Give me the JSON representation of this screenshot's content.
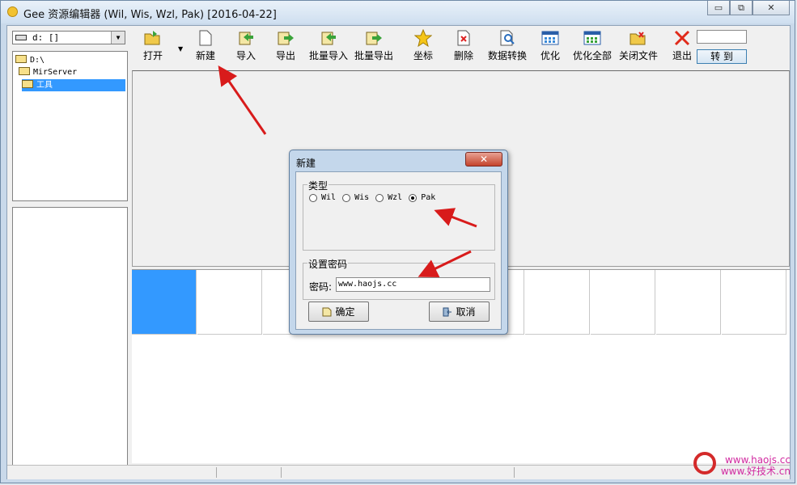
{
  "window": {
    "title": "Gee 资源编辑器 (Wil, Wis, Wzl, Pak) [2016-04-22]"
  },
  "window_buttons": {
    "minimize": "▭",
    "restore": "⧉",
    "close": "✕"
  },
  "drive": {
    "value": "d: []"
  },
  "tree": {
    "items": [
      "D:\\",
      "MirServer",
      "工具"
    ],
    "selected": "工具"
  },
  "toolbar": {
    "items": [
      {
        "label": "打开",
        "icon": "open-folder-icon"
      },
      {
        "label": "新建",
        "icon": "new-file-icon"
      },
      {
        "label": "导入",
        "icon": "import-icon"
      },
      {
        "label": "导出",
        "icon": "export-icon"
      },
      {
        "label": "批量导入",
        "icon": "batch-import-icon"
      },
      {
        "label": "批量导出",
        "icon": "batch-export-icon"
      },
      {
        "label": "坐标",
        "icon": "star-icon"
      },
      {
        "label": "删除",
        "icon": "delete-icon"
      },
      {
        "label": "数据转换",
        "icon": "convert-icon"
      },
      {
        "label": "优化",
        "icon": "optimize-icon"
      },
      {
        "label": "优化全部",
        "icon": "optimize-all-icon"
      },
      {
        "label": "关闭文件",
        "icon": "close-file-icon"
      },
      {
        "label": "退出",
        "icon": "exit-icon"
      }
    ],
    "goto_label": "转 到",
    "goto_value": ""
  },
  "dialog": {
    "title": "新建",
    "close": "✕",
    "type_group": "类型",
    "types": [
      "Wil",
      "Wis",
      "Wzl",
      "Pak"
    ],
    "selected_type": "Pak",
    "password_group": "设置密码",
    "password_label": "密码:",
    "password_value": "www.haojs.cc",
    "ok_label": "确定",
    "cancel_label": "取消"
  },
  "watermark": {
    "line1": "www.haojs.cc",
    "line2": "www.好技术.cn"
  },
  "colors": {
    "selection": "#3399ff",
    "annotation_arrow": "#d81b1b",
    "watermark": "#d12aa0"
  }
}
